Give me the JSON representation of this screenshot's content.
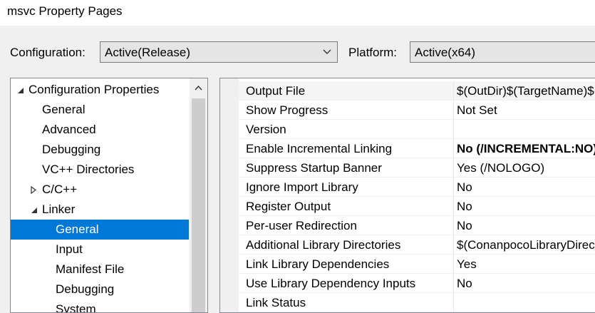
{
  "window": {
    "title": "msvc Property Pages"
  },
  "toolbar": {
    "configuration_label": "Configuration:",
    "configuration_value": "Active(Release)",
    "platform_label": "Platform:",
    "platform_value": "Active(x64)"
  },
  "tree": {
    "items": [
      {
        "label": "Configuration Properties",
        "expanded": true,
        "selected": false
      },
      {
        "label": "General",
        "selected": false
      },
      {
        "label": "Advanced",
        "selected": false
      },
      {
        "label": "Debugging",
        "selected": false
      },
      {
        "label": "VC++ Directories",
        "selected": false
      },
      {
        "label": "C/C++",
        "expanded": false,
        "selected": false
      },
      {
        "label": "Linker",
        "expanded": true,
        "selected": false
      },
      {
        "label": "General",
        "selected": true
      },
      {
        "label": "Input",
        "selected": false
      },
      {
        "label": "Manifest File",
        "selected": false
      },
      {
        "label": "Debugging",
        "selected": false
      },
      {
        "label": "System",
        "selected": false
      }
    ]
  },
  "properties": [
    {
      "name": "Output File",
      "value": "$(OutDir)$(TargetName)$(TargetExt)"
    },
    {
      "name": "Show Progress",
      "value": "Not Set"
    },
    {
      "name": "Version",
      "value": ""
    },
    {
      "name": "Enable Incremental Linking",
      "value": "No (/INCREMENTAL:NO)"
    },
    {
      "name": "Suppress Startup Banner",
      "value": "Yes (/NOLOGO)"
    },
    {
      "name": "Ignore Import Library",
      "value": "No"
    },
    {
      "name": "Register Output",
      "value": "No"
    },
    {
      "name": "Per-user Redirection",
      "value": "No"
    },
    {
      "name": "Additional Library Directories",
      "value": "$(ConanpocoLibraryDirectories)"
    },
    {
      "name": "Link Library Dependencies",
      "value": "Yes"
    },
    {
      "name": "Use Library Dependency Inputs",
      "value": "No"
    },
    {
      "name": "Link Status",
      "value": ""
    }
  ],
  "colors": {
    "selection": "#0078d7",
    "window_bg": "#f0f0f0",
    "panel_bg": "#ffffff"
  },
  "icons": {
    "expanded": "collapse-triangle-icon",
    "collapsed": "expand-triangle-icon",
    "dropdown": "chevron-down-icon",
    "scroll_up": "scroll-up-arrow-icon"
  }
}
